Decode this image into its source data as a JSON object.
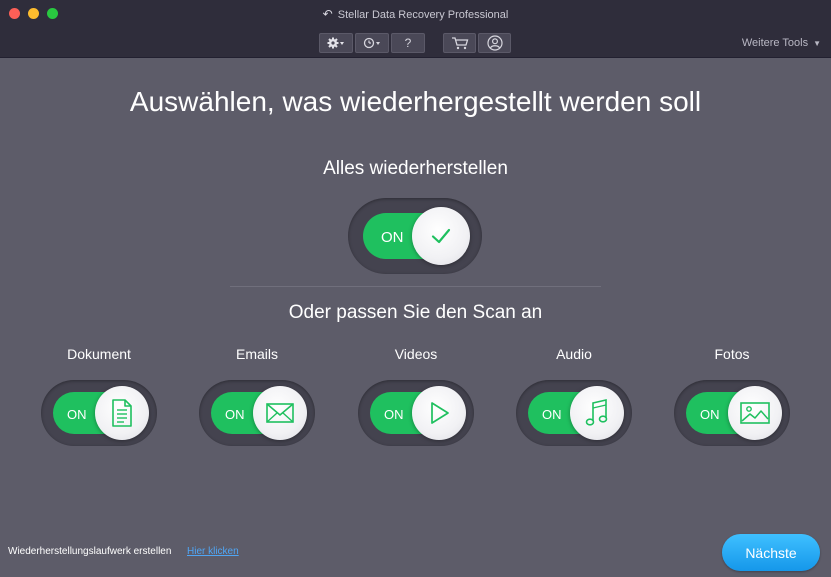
{
  "window": {
    "title": "Stellar Data Recovery Professional"
  },
  "toolbar": {
    "settings_icon": "gear-icon",
    "history_icon": "history-icon",
    "help_label": "?",
    "cart_icon": "cart-icon",
    "account_icon": "user-icon",
    "more_tools_label": "Weitere Tools"
  },
  "main": {
    "headline": "Auswählen, was wiederhergestellt werden soll",
    "recover_all_label": "Alles wiederherstellen",
    "recover_all_toggle": "ON",
    "customize_label": "Oder passen Sie den Scan an",
    "categories": [
      {
        "label": "Dokument",
        "toggle": "ON",
        "icon": "document-icon"
      },
      {
        "label": "Emails",
        "toggle": "ON",
        "icon": "email-icon"
      },
      {
        "label": "Videos",
        "toggle": "ON",
        "icon": "play-icon"
      },
      {
        "label": "Audio",
        "toggle": "ON",
        "icon": "music-note-icon"
      },
      {
        "label": "Fotos",
        "toggle": "ON",
        "icon": "image-icon"
      }
    ]
  },
  "footer": {
    "recovery_drive_text": "Wiederherstellungslaufwerk erstellen",
    "recovery_drive_link": "Hier klicken",
    "next_button": "Nächste"
  },
  "colors": {
    "toggle_on": "#1fc05f",
    "accent_blue": "#1597ea",
    "background": "#5d5c69"
  }
}
